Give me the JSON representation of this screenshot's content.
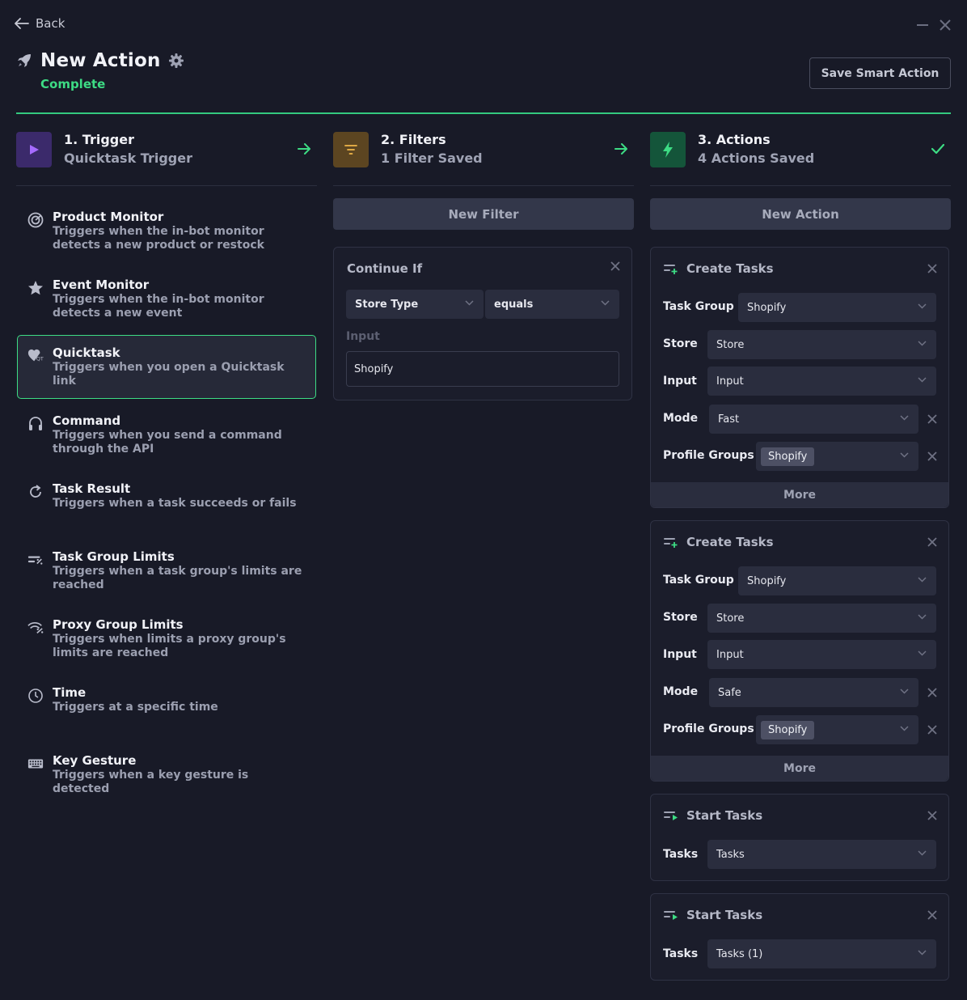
{
  "header": {
    "back_label": "Back",
    "title": "New Action",
    "status": "Complete",
    "save_button": "Save Smart Action"
  },
  "colors": {
    "background": "#181a27",
    "accent_green": "#3ddc84",
    "trigger_icon_bg": "#3b2a6b",
    "filter_icon_bg": "#5c4521",
    "actions_icon_bg": "#14553a"
  },
  "steps": [
    {
      "title": "1. Trigger",
      "subtitle": "Quicktask Trigger",
      "icon": "play-icon",
      "status_icon": "arrow-right-icon"
    },
    {
      "title": "2. Filters",
      "subtitle": "1 Filter Saved",
      "icon": "filter-icon",
      "status_icon": "arrow-right-icon"
    },
    {
      "title": "3. Actions",
      "subtitle": "4 Actions Saved",
      "icon": "lightning-icon",
      "status_icon": "check-icon"
    }
  ],
  "triggers": [
    {
      "name": "Product Monitor",
      "desc": "Triggers when the in-bot monitor detects a new product or restock",
      "icon": "radar-icon",
      "selected": false
    },
    {
      "name": "Event Monitor",
      "desc": "Triggers when the in-bot monitor detects a new event",
      "icon": "star-icon",
      "selected": false
    },
    {
      "name": "Quicktask",
      "desc": "Triggers when you open a Quicktask link",
      "icon": "quicktask-icon",
      "selected": true
    },
    {
      "name": "Command",
      "desc": "Triggers when you send a command through the API",
      "icon": "headset-icon",
      "selected": false
    },
    {
      "name": "Task Result",
      "desc": "Triggers when a task succeeds or fails",
      "icon": "refresh-icon",
      "selected": false
    },
    {
      "name": "Task Group Limits",
      "desc": "Triggers when a task group's limits are reached",
      "icon": "task-group-icon",
      "selected": false
    },
    {
      "name": "Proxy Group Limits",
      "desc": "Triggers when limits a proxy group's limits are reached",
      "icon": "wifi-icon",
      "selected": false
    },
    {
      "name": "Time",
      "desc": "Triggers at a specific time",
      "icon": "clock-icon",
      "selected": false
    },
    {
      "name": "Key Gesture",
      "desc": "Triggers when a key gesture is detected",
      "icon": "keyboard-icon",
      "selected": false
    }
  ],
  "filters": {
    "new_button": "New Filter",
    "card": {
      "title": "Continue If",
      "field": "Store Type",
      "operator": "equals",
      "input_label": "Input",
      "input_value": "Shopify"
    }
  },
  "actions": {
    "new_button": "New Action",
    "cards": [
      {
        "title": "Create Tasks",
        "labels": {
          "task_group": "Task Group",
          "store": "Store",
          "input": "Input",
          "mode": "Mode",
          "profile_groups": "Profile Groups"
        },
        "values": {
          "task_group": "Shopify",
          "store": "Store",
          "input": "Input",
          "mode": "Fast",
          "profile_groups": "Shopify"
        },
        "more": "More"
      },
      {
        "title": "Create Tasks",
        "labels": {
          "task_group": "Task Group",
          "store": "Store",
          "input": "Input",
          "mode": "Mode",
          "profile_groups": "Profile Groups"
        },
        "values": {
          "task_group": "Shopify",
          "store": "Store",
          "input": "Input",
          "mode": "Safe",
          "profile_groups": "Shopify"
        },
        "more": "More"
      },
      {
        "title": "Start Tasks",
        "label": "Tasks",
        "value": "Tasks"
      },
      {
        "title": "Start Tasks",
        "label": "Tasks",
        "value": "Tasks (1)"
      }
    ]
  }
}
